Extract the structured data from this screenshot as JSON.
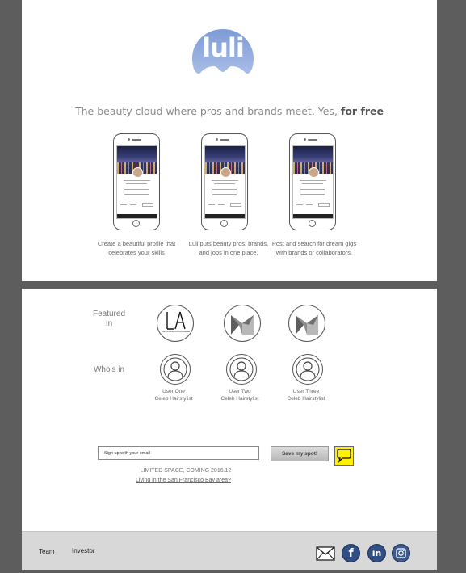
{
  "brand": {
    "logo_text": "luli",
    "logo_color": "#8ea7d8"
  },
  "hero": {
    "tagline": "The beauty cloud where pros and brands meet. Yes,",
    "tagline_emphasis": "for free"
  },
  "features": [
    {
      "caption": "Create a beautiful profile that celebrates your skills"
    },
    {
      "caption": "Luli puts beauty pros, brands, and jobs in one place."
    },
    {
      "caption": "Post and search for dream gigs with brands or collaborators."
    }
  ],
  "featured": {
    "label": "Featured In",
    "logos": [
      {
        "text": "LA",
        "subtext": "DE LA FASHION MAGAZINE"
      },
      {
        "text": ""
      },
      {
        "text": ""
      }
    ]
  },
  "whos_in": {
    "label": "Who's in",
    "users": [
      {
        "name": "User One",
        "role": "Celeb Hairstylist"
      },
      {
        "name": "User Two",
        "role": "Celeb Hairstylist"
      },
      {
        "name": "User Three",
        "role": "Celeb Hairstylist"
      }
    ]
  },
  "signup": {
    "email_placeholder": "Sign up with your email",
    "button_label": "Save my spot!",
    "limited_text": "LIMITED SPACE, COMING 2016.12",
    "bay_area_link": "Living in the San Francisco Bay area?"
  },
  "footer": {
    "links": [
      "Team",
      "Investor"
    ],
    "social": [
      {
        "icon": "mail-icon"
      },
      {
        "icon": "facebook-icon",
        "glyph": "f"
      },
      {
        "icon": "linkedin-icon",
        "glyph": "in"
      },
      {
        "icon": "instagram-icon"
      }
    ]
  }
}
